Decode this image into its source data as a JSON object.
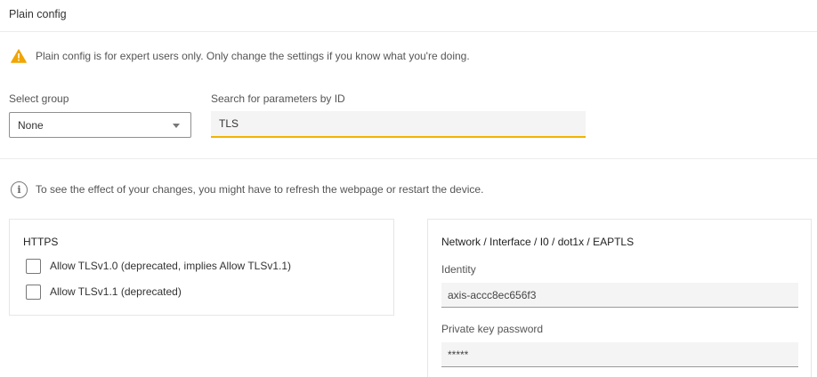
{
  "page": {
    "title": "Plain config"
  },
  "warning": {
    "icon": "warning-icon",
    "text": "Plain config is for expert users only. Only change the settings if you know what you're doing."
  },
  "group_select": {
    "label": "Select group",
    "value": "None",
    "icon": "chevron-down-icon"
  },
  "search": {
    "label": "Search for parameters by ID",
    "value": "TLS",
    "accent_color": "#f0b400"
  },
  "info": {
    "icon": "info-icon",
    "text": "To see the effect of your changes, you might have to refresh the webpage or restart the device."
  },
  "https_card": {
    "title": "HTTPS",
    "options": [
      {
        "label": "Allow TLSv1.0 (deprecated, implies Allow TLSv1.1)",
        "checked": false
      },
      {
        "label": "Allow TLSv1.1 (deprecated)",
        "checked": false
      }
    ]
  },
  "network_card": {
    "title": "Network / Interface / I0 / dot1x / EAPTLS",
    "fields": [
      {
        "label": "Identity",
        "value": "axis-accc8ec656f3"
      },
      {
        "label": "Private key password",
        "value": "*****"
      }
    ]
  }
}
